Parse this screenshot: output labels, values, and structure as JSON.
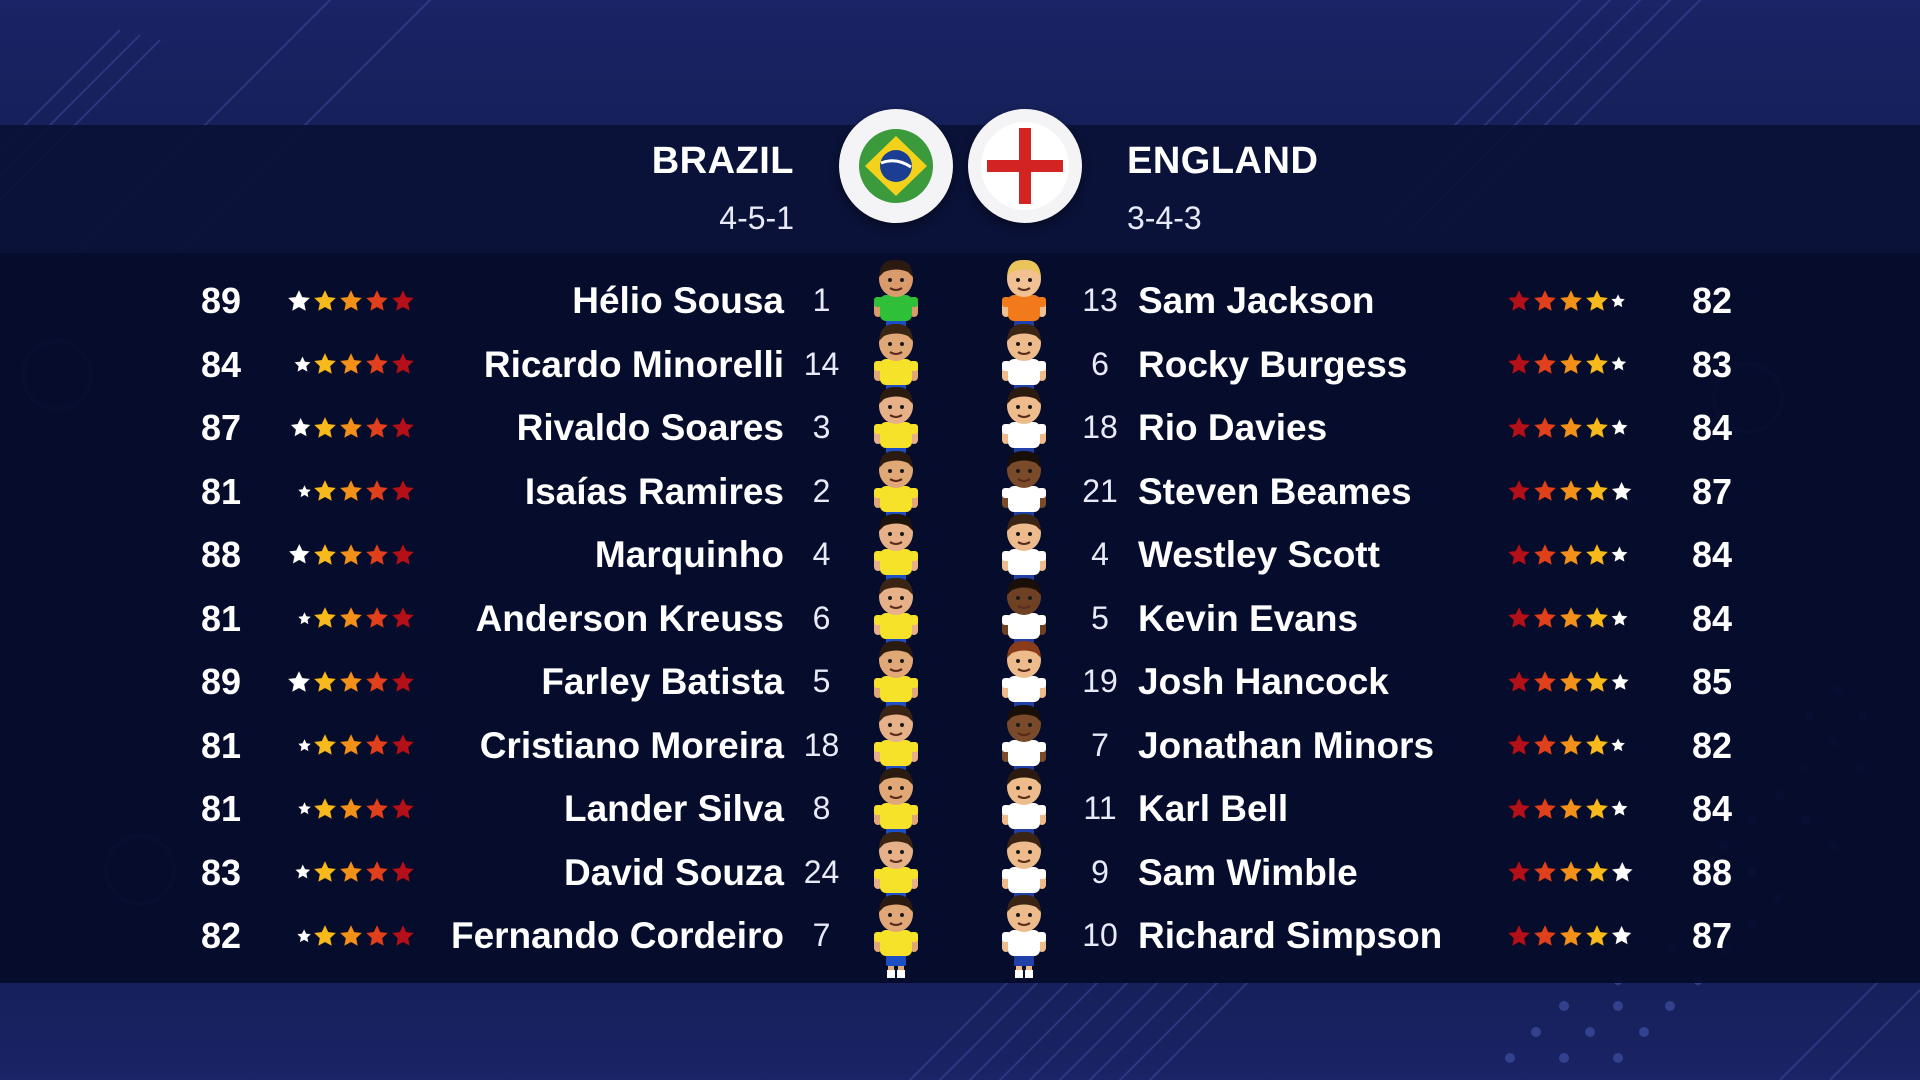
{
  "home": {
    "name": "BRAZIL",
    "formation": "4-5-1",
    "flag_icon": "brazil-flag-icon",
    "kit": {
      "shirt": "#f7e22a",
      "shorts": "#1d4fc4",
      "keeper_shirt": "#2fbf39"
    },
    "players": [
      {
        "rating": "89",
        "number": "1",
        "name": "Hélio Sousa",
        "position": "goalkeeper",
        "skin": "#d99a6c",
        "hair": "#2b1a10"
      },
      {
        "rating": "84",
        "number": "14",
        "name": "Ricardo Minorelli",
        "position": "outfield",
        "skin": "#e0a777",
        "hair": "#3a2414"
      },
      {
        "rating": "87",
        "number": "3",
        "name": "Rivaldo Soares",
        "position": "outfield",
        "skin": "#e6b088",
        "hair": "#2b1a10"
      },
      {
        "rating": "81",
        "number": "2",
        "name": "Isaías Ramires",
        "position": "outfield",
        "skin": "#e0a777",
        "hair": "#2b1a10"
      },
      {
        "rating": "88",
        "number": "4",
        "name": "Marquinho",
        "position": "outfield",
        "skin": "#e6b088",
        "hair": "#1e140c"
      },
      {
        "rating": "81",
        "number": "6",
        "name": "Anderson Kreuss",
        "position": "outfield",
        "skin": "#e6b088",
        "hair": "#3a2414"
      },
      {
        "rating": "89",
        "number": "5",
        "name": "Farley Batista",
        "position": "outfield",
        "skin": "#e0a777",
        "hair": "#2b1a10"
      },
      {
        "rating": "81",
        "number": "18",
        "name": "Cristiano Moreira",
        "position": "outfield",
        "skin": "#e6b088",
        "hair": "#3a2414"
      },
      {
        "rating": "81",
        "number": "8",
        "name": "Lander Silva",
        "position": "outfield",
        "skin": "#e0a777",
        "hair": "#2b1a10"
      },
      {
        "rating": "83",
        "number": "24",
        "name": "David Souza",
        "position": "outfield",
        "skin": "#e6b088",
        "hair": "#3a2414"
      },
      {
        "rating": "82",
        "number": "7",
        "name": "Fernando Cordeiro",
        "position": "outfield",
        "skin": "#e0a777",
        "hair": "#2b1a10"
      }
    ]
  },
  "away": {
    "name": "ENGLAND",
    "formation": "3-4-3",
    "flag_icon": "england-flag-icon",
    "kit": {
      "shirt": "#ffffff",
      "shorts": "#2140a8",
      "keeper_shirt": "#f27a1a"
    },
    "players": [
      {
        "rating": "82",
        "number": "13",
        "name": "Sam Jackson",
        "position": "goalkeeper",
        "skin": "#f1c193",
        "hair": "#e9c45a"
      },
      {
        "rating": "83",
        "number": "6",
        "name": "Rocky Burgess",
        "position": "outfield",
        "skin": "#eebb8c",
        "hair": "#3a2414"
      },
      {
        "rating": "84",
        "number": "18",
        "name": "Rio Davies",
        "position": "outfield",
        "skin": "#eebb8c",
        "hair": "#2b1a10"
      },
      {
        "rating": "87",
        "number": "21",
        "name": "Steven Beames",
        "position": "outfield",
        "skin": "#7a4b2a",
        "hair": "#1a0f08"
      },
      {
        "rating": "84",
        "number": "4",
        "name": "Westley Scott",
        "position": "outfield",
        "skin": "#eebb8c",
        "hair": "#3a2414"
      },
      {
        "rating": "84",
        "number": "5",
        "name": "Kevin Evans",
        "position": "outfield",
        "skin": "#6e4125",
        "hair": "#1a0f08"
      },
      {
        "rating": "85",
        "number": "19",
        "name": "Josh Hancock",
        "position": "outfield",
        "skin": "#eebb8c",
        "hair": "#8a3b1a"
      },
      {
        "rating": "82",
        "number": "7",
        "name": "Jonathan Minors",
        "position": "outfield",
        "skin": "#7a4b2a",
        "hair": "#1a0f08"
      },
      {
        "rating": "84",
        "number": "11",
        "name": "Karl Bell",
        "position": "outfield",
        "skin": "#eebb8c",
        "hair": "#2b1a10"
      },
      {
        "rating": "88",
        "number": "9",
        "name": "Sam Wimble",
        "position": "outfield",
        "skin": "#eebb8c",
        "hair": "#3a2414"
      },
      {
        "rating": "87",
        "number": "10",
        "name": "Richard Simpson",
        "position": "outfield",
        "skin": "#eebb8c",
        "hair": "#3a2414"
      }
    ]
  },
  "star_colors": [
    "#ffffff",
    "#f7b91c",
    "#f2901a",
    "#e0401c",
    "#b3101a"
  ],
  "accent_colors": {
    "background": "#131c4f",
    "panel": "#050b2a",
    "header": "#0a1137"
  }
}
